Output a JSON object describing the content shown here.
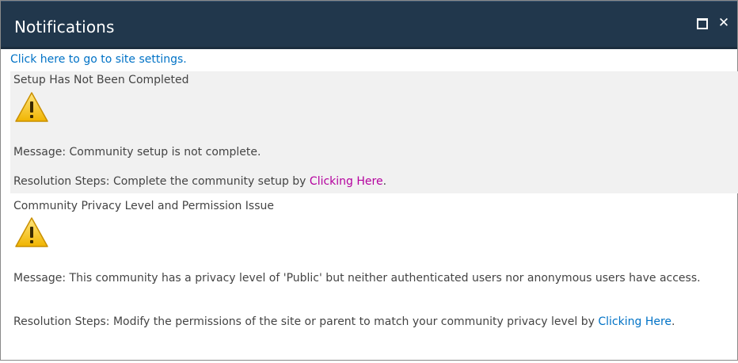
{
  "window": {
    "title": "Notifications",
    "maximize_icon": "maximize-icon",
    "close_icon": "close-icon",
    "close_glyph": "✕"
  },
  "settings_link": "Click here to go to site settings.",
  "notifications": [
    {
      "heading": "Setup Has Not Been Completed",
      "icon": "warning-icon",
      "message": "Message: Community setup is not complete.",
      "resolution_prefix": "Resolution Steps: Complete the community setup by ",
      "resolution_link": "Clicking Here",
      "resolution_suffix": "."
    },
    {
      "heading": "Community Privacy Level and Permission Issue",
      "icon": "warning-icon",
      "message": "Message: This community has a privacy level of 'Public' but neither authenticated users nor anonymous users have access.",
      "resolution_prefix": "Resolution Steps: Modify the permissions of the site or parent to match your community privacy level by ",
      "resolution_link": "Clicking Here",
      "resolution_suffix": "."
    }
  ],
  "colors": {
    "titlebar": "#21374c",
    "link": "#0072c6",
    "visited_link": "#b4009e",
    "highlight_row": "#f1f1f1",
    "warning": "#f5c518"
  }
}
